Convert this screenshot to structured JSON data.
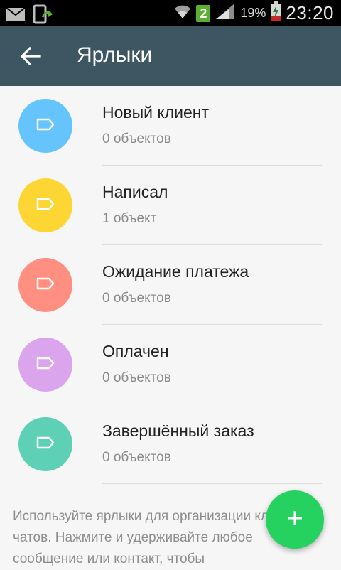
{
  "status_bar": {
    "sim_badge": "2",
    "battery_percent": "19%",
    "time": "23:20",
    "icons": [
      "email-icon",
      "download-icon",
      "wifi-icon",
      "signal-icon",
      "battery-charging-icon"
    ]
  },
  "app_bar": {
    "title": "Ярлыки",
    "back_icon": "arrow-left-icon",
    "color": "#3e5661"
  },
  "labels": [
    {
      "name": "Новый клиент",
      "count": "0 объектов",
      "color": "#64c4fb"
    },
    {
      "name": "Написал",
      "count": "1 объект",
      "color": "#fdd633"
    },
    {
      "name": "Ожидание платежа",
      "count": "0 объектов",
      "color": "#ff8f80"
    },
    {
      "name": "Оплачен",
      "count": "0 объектов",
      "color": "#dba5ee"
    },
    {
      "name": "Завершённый заказ",
      "count": "0 объектов",
      "color": "#5ed0b5"
    }
  ],
  "hint": "Используйте ярлыки для организации клиентов и чатов. Нажмите и удерживайте любое сообщение или контакт, чтобы",
  "fab": {
    "icon": "plus-icon",
    "color": "#25d25f"
  }
}
